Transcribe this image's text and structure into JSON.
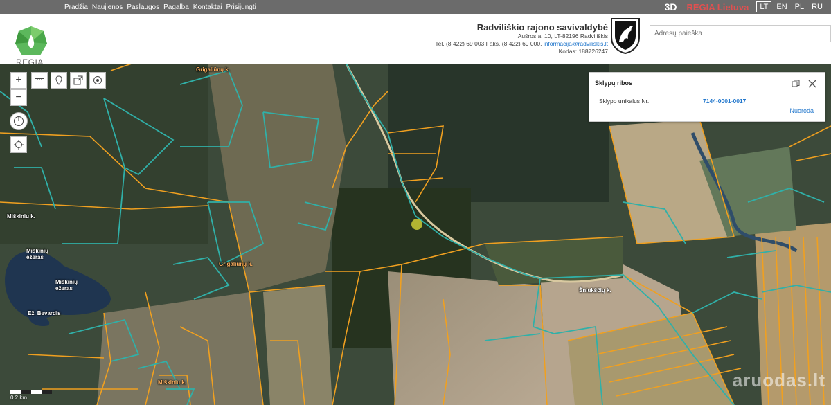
{
  "nav": [
    "Pradžia",
    "Naujienos",
    "Paslaugos",
    "Pagalba",
    "Kontaktai",
    "Prisijungti"
  ],
  "top": {
    "btn3d": "3D",
    "brand": "REGIA Lietuva",
    "languages": [
      "LT",
      "EN",
      "PL",
      "RU"
    ],
    "active_lang": "LT"
  },
  "logo": {
    "text": "REGIA"
  },
  "municipality": {
    "name": "Radviliškio rajono savivaldybė",
    "address": "Aušros a. 10, LT-82196 Radviliškis",
    "phone": "Tel. (8 422) 69 003 Faks. (8 422) 69 000,",
    "email": "informacija@radviliskis.lt",
    "code": "Kodas: 188726247"
  },
  "search": {
    "placeholder": "Adresų paieška"
  },
  "panel": {
    "title": "Sklypų ribos",
    "label": "Sklypo unikalus Nr.",
    "value": "7144-0001-0017",
    "link": "Nuoroda"
  },
  "map_labels": {
    "road1": "Grigaliūnų k.",
    "village1": "Miškinių k.",
    "lake1": "Miškinių\nežeras",
    "lake2": "Miškinių\nežeras",
    "road2": "Grigaliūnų k.",
    "lake3": "Ež. Bevardis",
    "village2": "Miškinių k.",
    "village3": "Šniukščių k."
  },
  "scale_label": "0.2 km",
  "watermark": "aruodas.lt",
  "colors": {
    "parcel_orange": "#f0a020",
    "cadastre_teal": "#30b0a8",
    "road": "#d9c9a0"
  }
}
